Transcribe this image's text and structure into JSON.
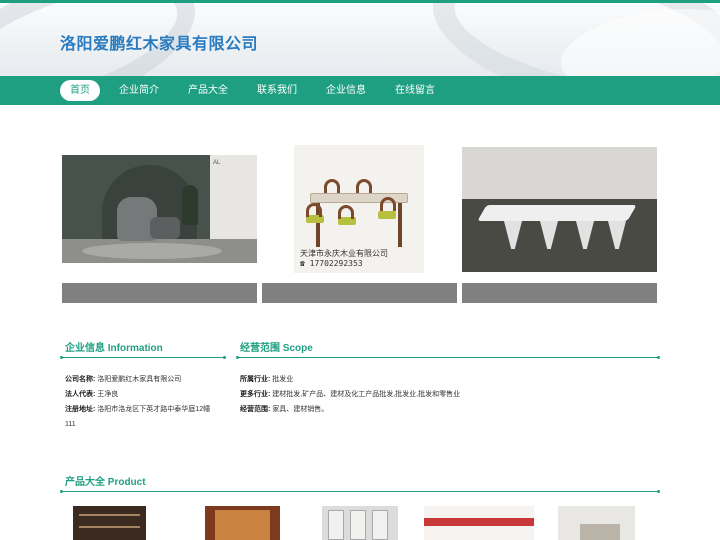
{
  "header": {
    "site_title": "洛阳爱鹏红木家具有限公司"
  },
  "nav": {
    "items": [
      {
        "label": "首页",
        "active": true
      },
      {
        "label": "企业简介",
        "active": false
      },
      {
        "label": "产品大全",
        "active": false
      },
      {
        "label": "联系我们",
        "active": false
      },
      {
        "label": "企业信息",
        "active": false
      },
      {
        "label": "在线留言",
        "active": false
      }
    ]
  },
  "gallery": {
    "img1_logo": "AL",
    "img2_watermark_line1": "天津市永庆木业有限公司",
    "img2_watermark_line2": "☎ 17702292353"
  },
  "company_info": {
    "title": "企业信息 Information",
    "rows": [
      {
        "label": "公司名称:",
        "value": "洛阳爱鹏红木家具有限公司"
      },
      {
        "label": "法人代表:",
        "value": "王净良"
      },
      {
        "label": "注册地址:",
        "value": "洛阳市洛龙区下英才路中泰华庭12幢"
      },
      {
        "label": "",
        "value": "111"
      }
    ]
  },
  "scope": {
    "title": "经营范围 Scope",
    "rows": [
      {
        "label": "所属行业:",
        "value": "批发业"
      },
      {
        "label": "更多行业:",
        "value": "建材批发,矿产品、建材及化工产品批发,批发业,批发和零售业"
      },
      {
        "label": "经营范围:",
        "value": "家具、建材销售。"
      }
    ]
  },
  "products": {
    "title": "产品大全 Product"
  },
  "colors": {
    "accent": "#1f9f82",
    "title_blue": "#2a7bbf",
    "bar_gray": "#808080"
  }
}
